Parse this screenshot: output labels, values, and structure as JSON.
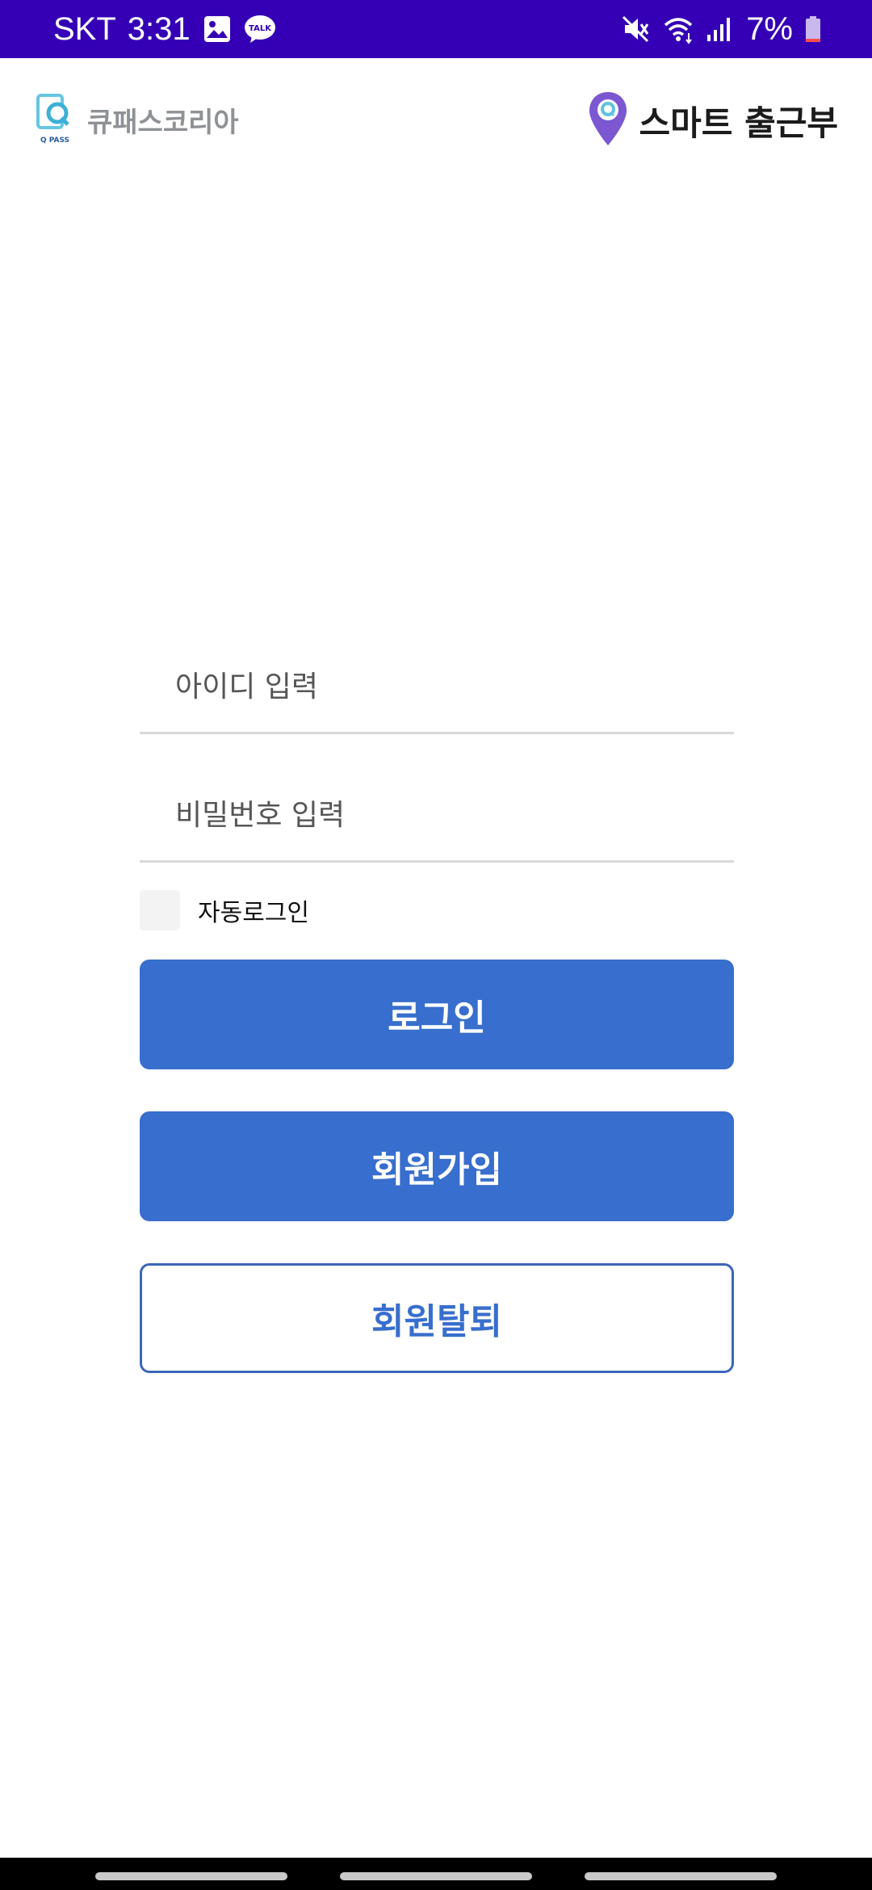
{
  "status_bar": {
    "carrier": "SKT",
    "time": "3:31",
    "battery": "7%",
    "left_icons": [
      "image-icon",
      "kakaotalk-icon"
    ],
    "right_icons": [
      "mute-icon",
      "wifi-icon",
      "signal-icon",
      "battery-icon"
    ],
    "talk_badge": "TALK",
    "background": "#3500B5"
  },
  "header": {
    "brand_logo_text": "Q PASS",
    "brand_name": "큐패스코리아",
    "app_title": "스마트 출근부",
    "pin_color": "#7b57d1"
  },
  "login_form": {
    "id_placeholder": "아이디 입력",
    "id_value": "",
    "password_placeholder": "비밀번호 입력",
    "password_value": "",
    "auto_login_label": "자동로그인",
    "auto_login_checked": false
  },
  "buttons": {
    "login": "로그인",
    "signup": "회원가입",
    "withdraw": "회원탈퇴",
    "primary_color": "#386ecd"
  }
}
